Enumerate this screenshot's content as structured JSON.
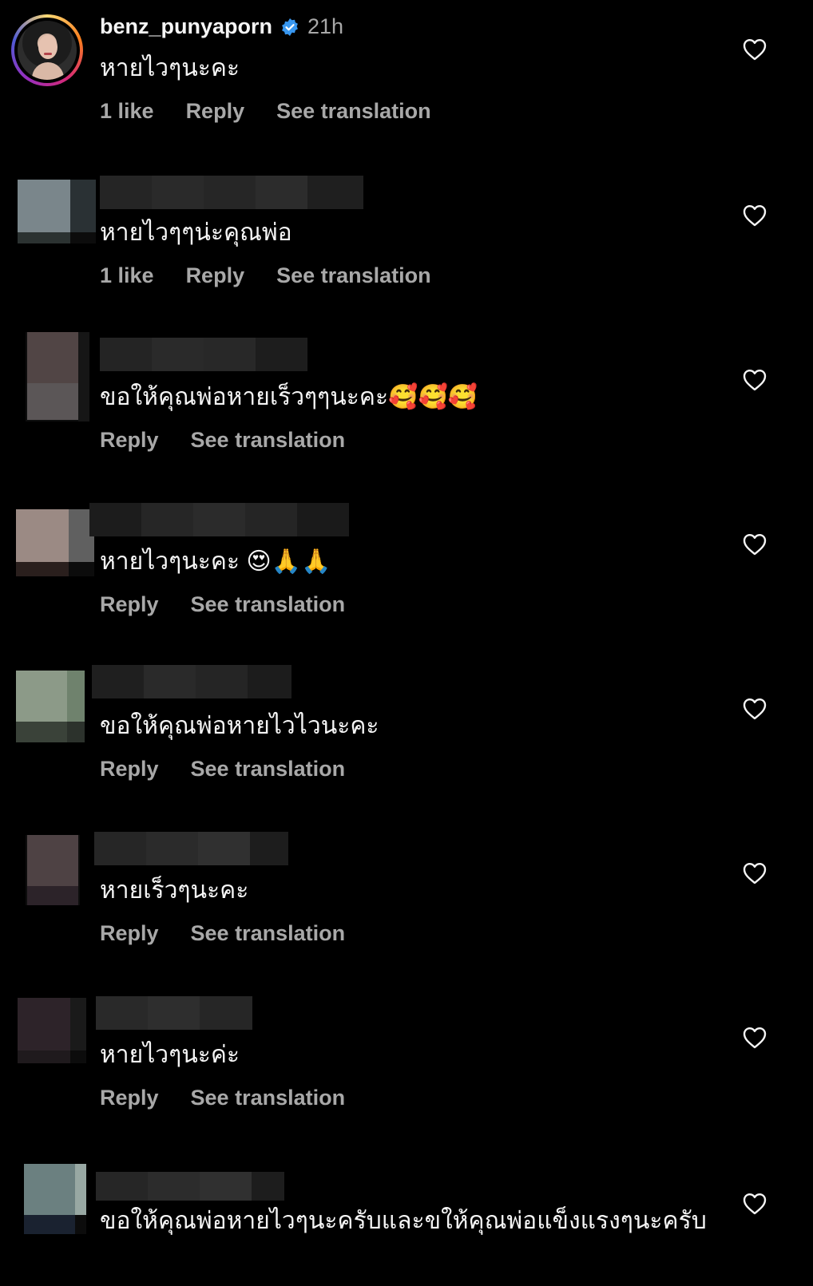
{
  "comments": [
    {
      "username": "benz_punyaporn",
      "verified": true,
      "time": "21h",
      "text": "หายไวๆนะคะ",
      "likes": "1 like",
      "reply": "Reply",
      "translate": "See translation"
    },
    {
      "text": "หายไวๆๆน่ะคุณพ่อ",
      "likes": "1 like",
      "reply": "Reply",
      "translate": "See translation"
    },
    {
      "text": "ขอให้คุณพ่อหายเร็วๆๆนะคะ🥰🥰🥰",
      "reply": "Reply",
      "translate": "See translation"
    },
    {
      "text": "หายไวๆนะคะ 😍🙏🙏",
      "reply": "Reply",
      "translate": "See translation"
    },
    {
      "text": "ขอให้คุณพ่อหายไวไวนะคะ",
      "reply": "Reply",
      "translate": "See translation"
    },
    {
      "text": "หายเร็วๆนะคะ",
      "reply": "Reply",
      "translate": "See translation"
    },
    {
      "text": "หายไวๆนะค่ะ",
      "reply": "Reply",
      "translate": "See translation"
    },
    {
      "text": "ขอให้คุณพ่อหายไวๆนะครับและขให้คุณพ่อแข็งแรงๆนะครับ"
    }
  ],
  "icons": {
    "like": "heart-outline-icon",
    "verified": "verified-badge-icon"
  },
  "colors": {
    "background": "#000000",
    "text": "#f5f5f5",
    "secondary": "#a8a8a8",
    "verified": "#3897f0"
  }
}
